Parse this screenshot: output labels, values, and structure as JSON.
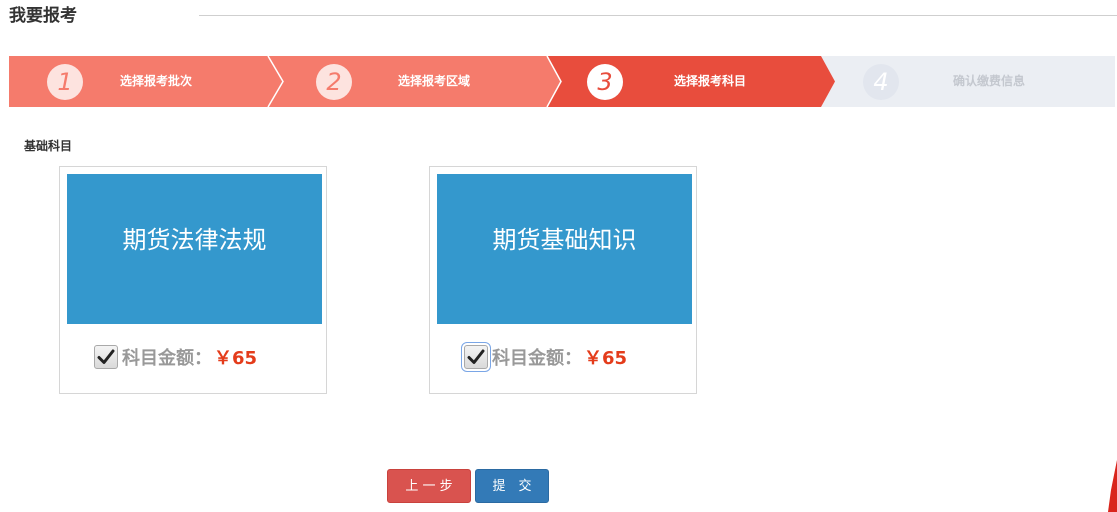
{
  "page": {
    "title": "我要报考"
  },
  "steps": [
    {
      "number": "1",
      "label": "选择报考批次",
      "state": "done"
    },
    {
      "number": "2",
      "label": "选择报考区域",
      "state": "done"
    },
    {
      "number": "3",
      "label": "选择报考科目",
      "state": "current"
    },
    {
      "number": "4",
      "label": "确认缴费信息",
      "state": "pending"
    }
  ],
  "section": {
    "label": "基础科目"
  },
  "subjects": [
    {
      "name": "期货法律法规",
      "fee_label": "科目金额：",
      "price": "￥65",
      "checked": true
    },
    {
      "name": "期货基础知识",
      "fee_label": "科目金额：",
      "price": "￥65",
      "checked": true
    }
  ],
  "actions": {
    "prev_label": "上 一 步",
    "submit_label": "提　交"
  },
  "colors": {
    "step_done": "#f57b6c",
    "step_current": "#e84d3d",
    "step_pending": "#ebeef3",
    "banner": "#3498cd",
    "price": "#e43c1b",
    "prev_button": "#d9534f",
    "submit_button": "#337ab7"
  },
  "icons": {
    "checkbox_mark": "check-icon"
  }
}
